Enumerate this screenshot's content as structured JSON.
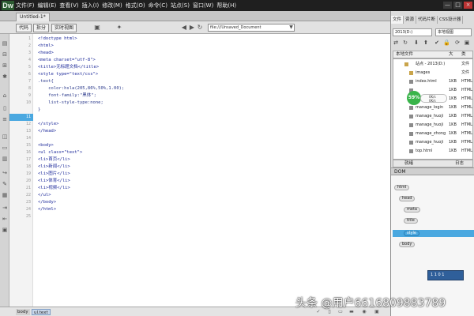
{
  "app": {
    "logo": "Dw"
  },
  "menu": [
    "文件(F)",
    "编辑(E)",
    "查看(V)",
    "插入(I)",
    "修改(M)",
    "格式(O)",
    "命令(C)",
    "站点(S)",
    "窗口(W)",
    "帮助(H)"
  ],
  "window_buttons": [
    "—",
    "□",
    "×"
  ],
  "document": {
    "tab_label": "Untitled-1*",
    "path": "",
    "views": [
      "代码",
      "拆分",
      "实时视图"
    ],
    "url": "file:///Unsaved_Document",
    "toolbar_icons": [
      "refresh-icon",
      "arrow-left-icon",
      "arrow-right-icon",
      "home-icon"
    ]
  },
  "code": {
    "lines": [
      "<!doctype html>",
      "<html>",
      "<head>",
      "<meta charset=\"utf-8\">",
      "<title>无标题文档</title>",
      "<style type=\"text/css\">",
      ".text{",
      "    color:hsla(205,86%,50%,1.00);",
      "    font-family:\"黑体\";",
      "    list-style-type:none;",
      "}",
      "</style>",
      "</head>",
      "",
      "<body>",
      "<ul class=\"text\">",
      "<li>首页</li>",
      "<li>新闻</li>",
      "<li>图片</li>",
      "<li>体育</li>",
      "<li>视频</li>",
      "</ul>",
      "</body>",
      "</html>",
      ""
    ],
    "line_numbers": [
      "1",
      "2",
      "3",
      "4",
      "5",
      "6",
      "7",
      "8",
      "9",
      "10",
      "11",
      "12",
      "13",
      "14",
      "15",
      "16",
      "17",
      "18",
      "19",
      "20",
      "21",
      "22",
      "23",
      "24",
      "25"
    ],
    "active_line": 11
  },
  "status": {
    "crumbs": [
      "body",
      "ul.text"
    ]
  },
  "right_panel": {
    "tabs": [
      "文件",
      "资源",
      "代码片断",
      "CSS设计器"
    ],
    "site_select": "2013(D:)",
    "view_select": "本地视图",
    "file_header": {
      "name": "本地文件",
      "size": "大",
      "type": "类"
    },
    "files": [
      {
        "name": "站点 - 2013(D:)",
        "size": "",
        "type": "文件",
        "folder": true
      },
      {
        "name": "images",
        "size": "",
        "type": "文件",
        "folder": true
      },
      {
        "name": "index.html",
        "size": "1KB",
        "type": "HTML",
        "folder": false
      },
      {
        "name": "",
        "size": "1KB",
        "type": "HTML",
        "folder": false
      },
      {
        "name": "",
        "size": "1KB",
        "type": "HTML",
        "folder": false
      },
      {
        "name": "manage_login",
        "size": "1KB",
        "type": "HTML",
        "folder": false
      },
      {
        "name": "manage_huoji",
        "size": "1KB",
        "type": "HTML",
        "folder": false
      },
      {
        "name": "manage_huoji",
        "size": "1KB",
        "type": "HTML",
        "folder": false
      },
      {
        "name": "manage_zhong",
        "size": "1KB",
        "type": "HTML",
        "folder": false
      },
      {
        "name": "manage_huoji",
        "size": "1KB",
        "type": "HTML",
        "folder": false
      },
      {
        "name": "top.html",
        "size": "1KB",
        "type": "HTML",
        "folder": false
      }
    ],
    "speed": {
      "value": "59%",
      "line1": "0K/s",
      "line2": "0K/s"
    },
    "footer": [
      "就绪",
      "日志"
    ],
    "dom_tab": "DOM",
    "dom_nodes": [
      "html",
      "head",
      "meta",
      "title",
      "style",
      "body"
    ],
    "mini_panel": "1 1 0 1"
  },
  "watermark": "头条 @用户6616809883789"
}
